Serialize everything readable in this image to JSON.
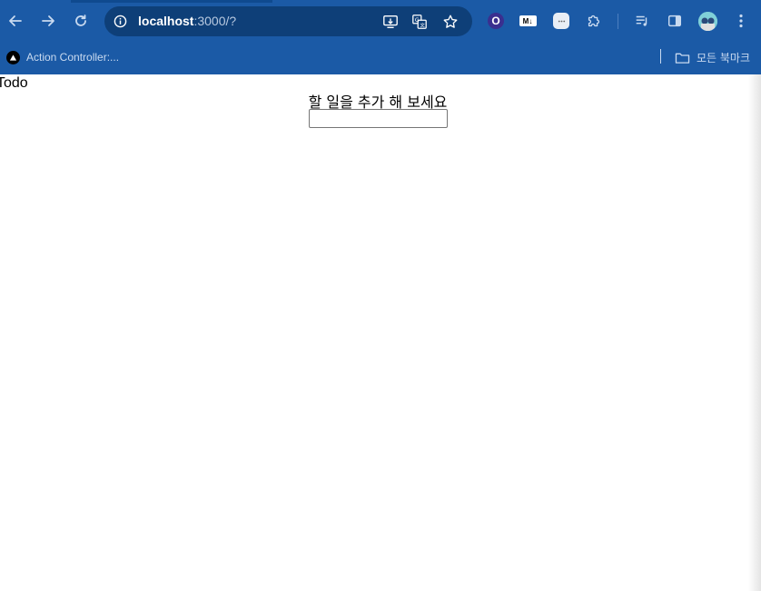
{
  "browser": {
    "url_host": "localhost",
    "url_path": ":3000/?",
    "icons": {
      "back": "arrow-left",
      "forward": "arrow-right",
      "reload": "reload",
      "site_info": "info-circle",
      "install": "install-app",
      "translate": "translate",
      "bookmark_star": "star",
      "extensions": "puzzle",
      "media": "media-playlist",
      "side_panel": "side-panel",
      "menu": "three-dots-vertical"
    },
    "extensions": {
      "o_label": "O",
      "md_label": "M↓"
    },
    "colors": {
      "toolbar": "#1b5aa6",
      "omnibox": "#0e3f78"
    }
  },
  "bookmarks": {
    "items": [
      {
        "label": "Action Controller:..."
      }
    ],
    "all_bookmarks_label": "모든 북마크"
  },
  "page": {
    "title": "Todo",
    "prompt": "할 일을 추가 해 보세요",
    "input": {
      "value": "",
      "placeholder": ""
    }
  }
}
